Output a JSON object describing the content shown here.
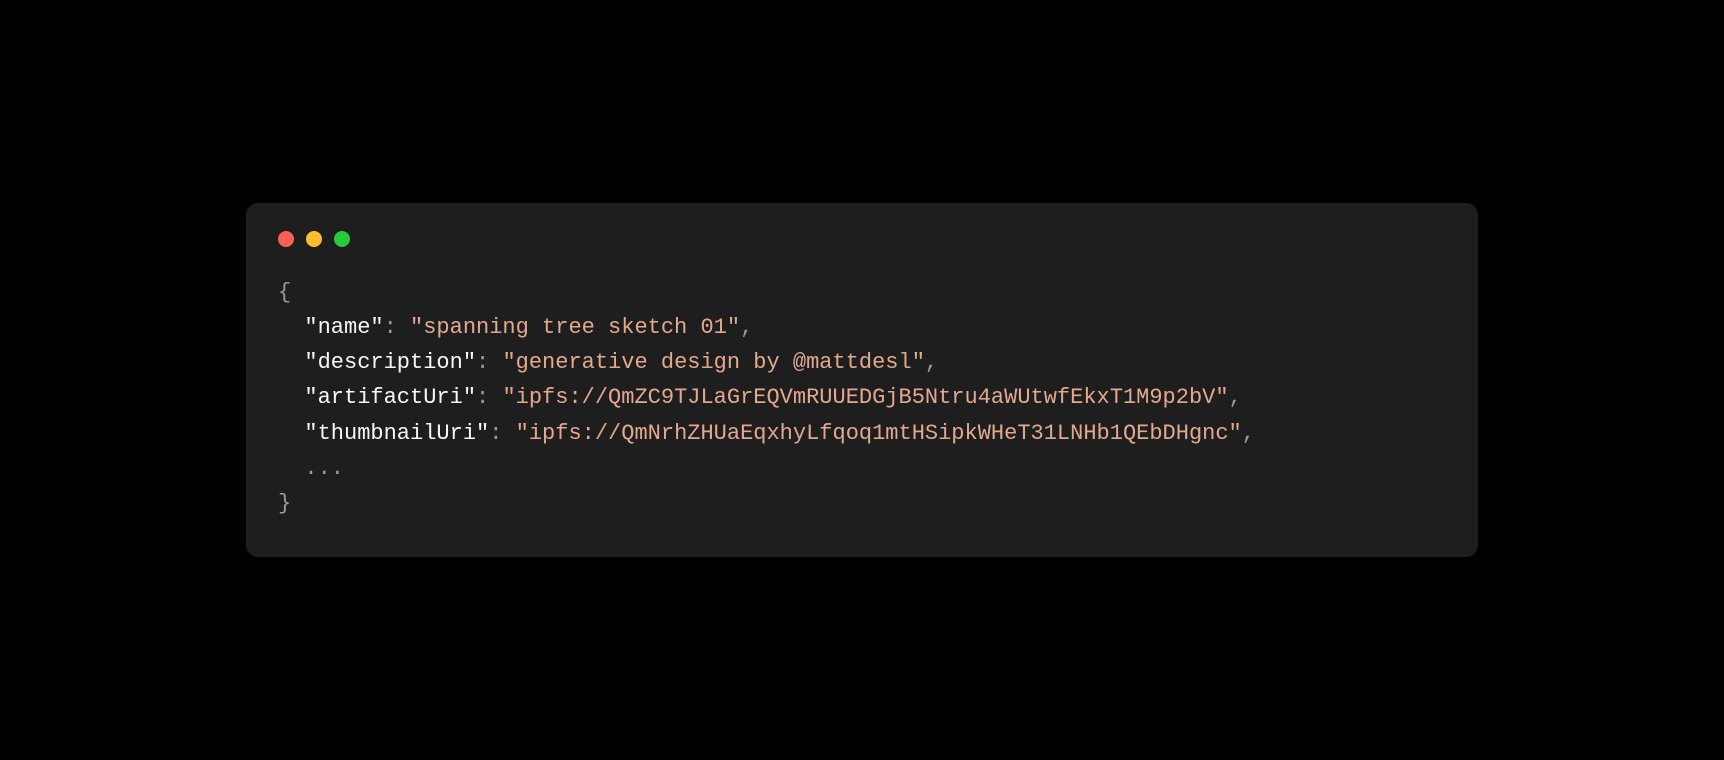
{
  "code": {
    "brace_open": "{",
    "brace_close": "}",
    "ellipsis": "...",
    "comma": ",",
    "colon": ":",
    "space": " ",
    "entries": [
      {
        "key": "\"name\"",
        "value": "\"spanning tree sketch 01\""
      },
      {
        "key": "\"description\"",
        "value": "\"generative design by @mattdesl\""
      },
      {
        "key": "\"artifactUri\"",
        "value": "\"ipfs://QmZC9TJLaGrEQVmRUUEDGjB5Ntru4aWUtwfEkxT1M9p2bV\""
      },
      {
        "key": "\"thumbnailUri\"",
        "value": "\"ipfs://QmNrhZHUaEqxhyLfqoq1mtHSipkWHeT31LNHb1QEbDHgnc\""
      }
    ]
  },
  "traffic_lights": {
    "red": "#ff5f56",
    "yellow": "#ffbd2e",
    "green": "#27c93f"
  }
}
